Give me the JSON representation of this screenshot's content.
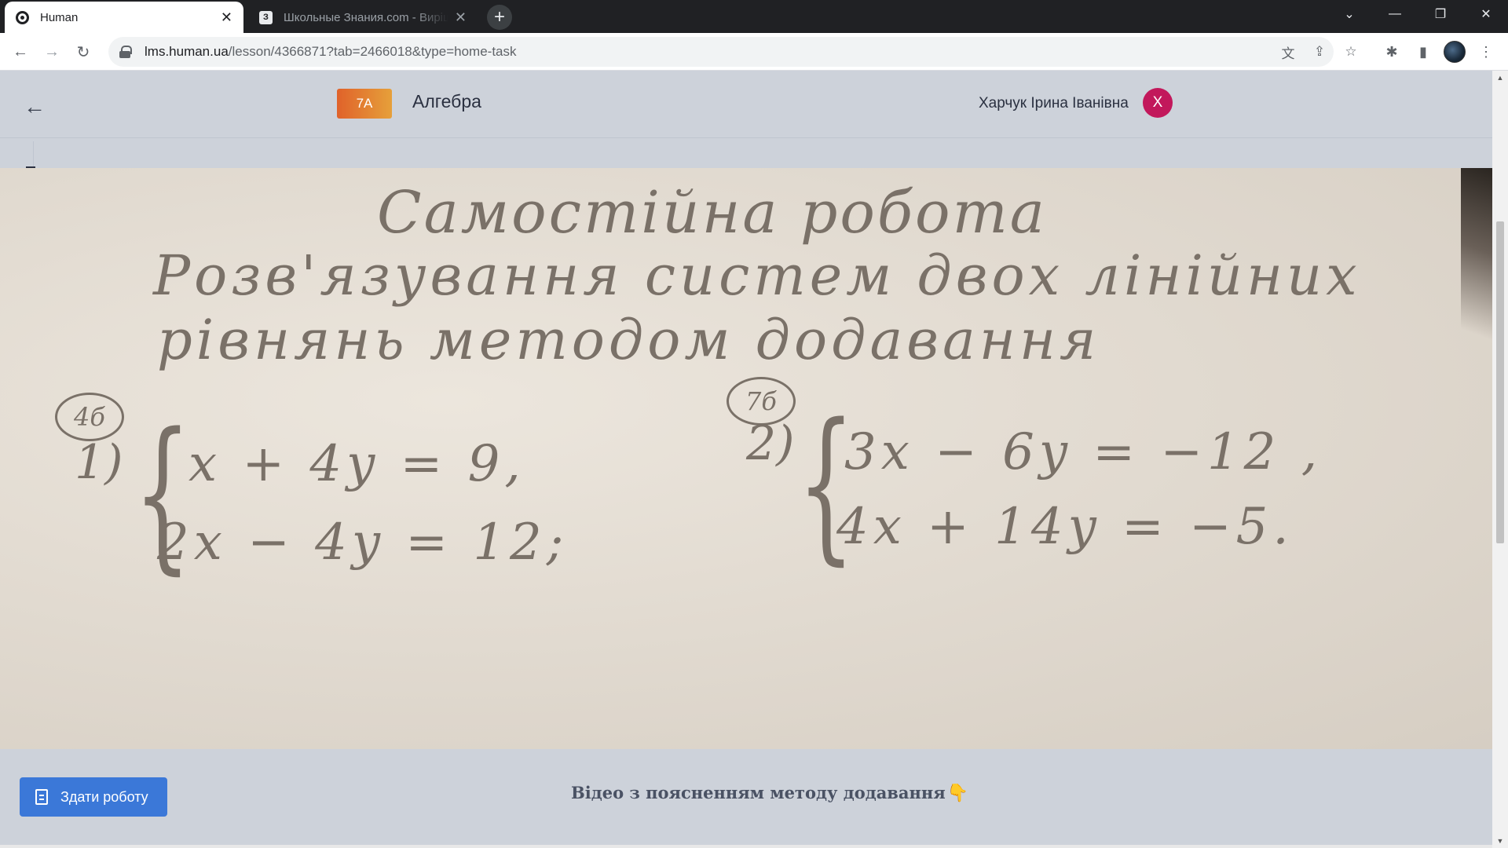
{
  "browser": {
    "tabs": [
      {
        "title": "Human",
        "active": true
      },
      {
        "title": "Школьные Знания.com - Вирішуйте домашні завдання",
        "favicon_letter": "З",
        "active": false
      }
    ],
    "url_host": "lms.human.ua",
    "url_path": "/lesson/4366871?tab=2466018&type=home-task"
  },
  "header": {
    "class_badge": "7А",
    "subject": "Алгебра",
    "teacher": "Харчук Ірина Іванівна",
    "avatar_letter": "Х"
  },
  "homework": {
    "title": "Самостійна робота",
    "subtitle_line1": "Розв'язування систем двох лінійних",
    "subtitle_line2": "рівнянь методом додавання",
    "task1": {
      "circle": "4б",
      "number": "1)",
      "eq1": "x + 4y = 9,",
      "eq2": "2x − 4y = 12;"
    },
    "task2": {
      "circle": "7б",
      "number": "2)",
      "eq1": "3x − 6y = −12 ,",
      "eq2": "4x + 14y = −5."
    }
  },
  "footer": {
    "submit_label": "Здати роботу",
    "video_caption": "Відео з поясненням методу додавання"
  },
  "colors": {
    "badge_gradient_start": "#e0622a",
    "badge_gradient_end": "#e6a03a",
    "avatar": "#c2185b",
    "submit_button": "#3b78d8"
  }
}
